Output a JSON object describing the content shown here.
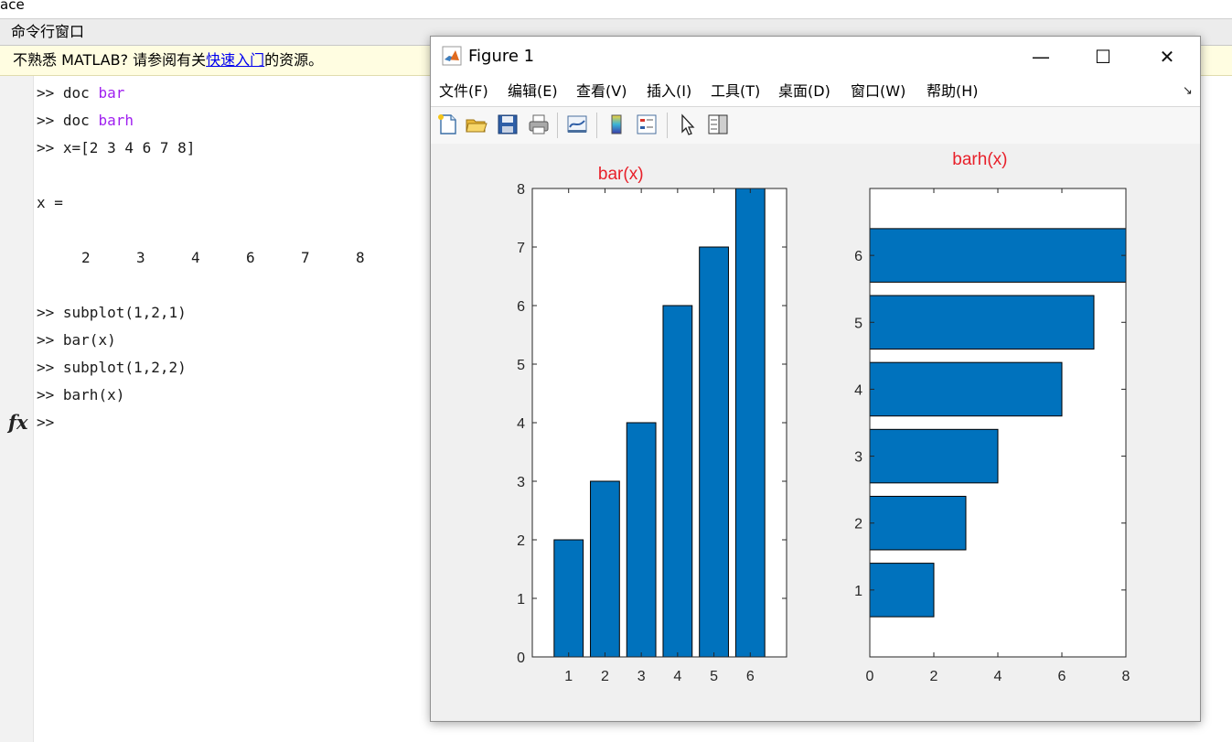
{
  "top_strip": {
    "text": "ace"
  },
  "command_window": {
    "header": "命令行窗口",
    "notice": {
      "prefix": "不熟悉 MATLAB? 请参阅有关",
      "link": "快速入门",
      "suffix": "的资源。"
    },
    "prompt": ">>",
    "fx_label": "fx",
    "lines": {
      "l1_cmd": "doc",
      "l1_arg": "bar",
      "l2_cmd": "doc",
      "l2_arg": "barh",
      "l3": "x=[2 3 4 6 7 8]",
      "var_echo": "x =",
      "values": [
        "2",
        "3",
        "4",
        "6",
        "7",
        "8"
      ],
      "l4": "subplot(1,2,1)",
      "l5": "bar(x)",
      "l6": "subplot(1,2,2)",
      "l7": "barh(x)"
    }
  },
  "figure_window": {
    "title": "Figure 1",
    "minimize": "—",
    "maximize": "☐",
    "close": "✕",
    "menus": [
      "文件(F)",
      "编辑(E)",
      "查看(V)",
      "插入(I)",
      "工具(T)",
      "桌面(D)",
      "窗口(W)",
      "帮助(H)"
    ],
    "dock_arrow": "↘",
    "toolbar_icons": [
      "new-figure-icon",
      "open-file-icon",
      "save-icon",
      "print-icon",
      "link-plot-icon",
      "colorbar-icon",
      "legend-icon",
      "pointer-icon",
      "property-editor-icon"
    ]
  },
  "chart_data": [
    {
      "type": "bar",
      "title": "bar(x)",
      "categories": [
        "1",
        "2",
        "3",
        "4",
        "5",
        "6"
      ],
      "values": [
        2,
        3,
        4,
        6,
        7,
        8
      ],
      "ylim": [
        0,
        8
      ],
      "yticks": [
        "0",
        "1",
        "2",
        "3",
        "4",
        "5",
        "6",
        "7",
        "8"
      ],
      "bar_color": "#0072bd",
      "title_color": "#e8202a"
    },
    {
      "type": "bar",
      "orientation": "horizontal",
      "title": "barh(x)",
      "categories": [
        "1",
        "2",
        "3",
        "4",
        "5",
        "6"
      ],
      "values": [
        2,
        3,
        4,
        6,
        7,
        8
      ],
      "xlim": [
        0,
        8
      ],
      "xticks": [
        "0",
        "2",
        "4",
        "6",
        "8"
      ],
      "bar_color": "#0072bd",
      "title_color": "#e8202a"
    }
  ]
}
